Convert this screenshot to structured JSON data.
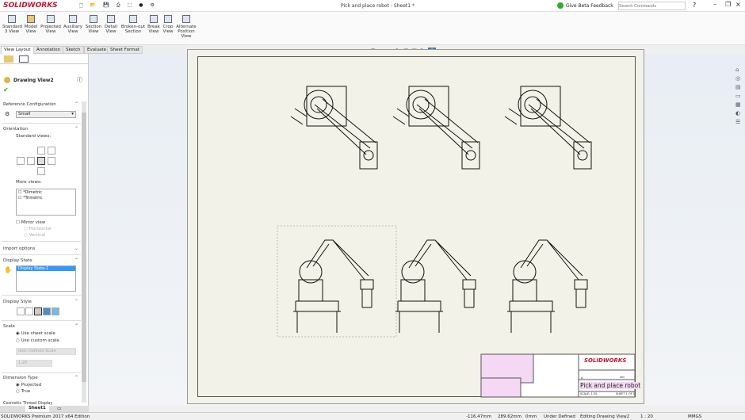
{
  "app": {
    "logo": "SOLIDWORKS",
    "title": "Pick and place robot - Sheet1 *",
    "feedback": "Give Beta Feedback",
    "search_placeholder": "Search Commands",
    "help": "?"
  },
  "ribbon": [
    {
      "label": "Standard 3 View"
    },
    {
      "label": "Model View"
    },
    {
      "label": "Projected View"
    },
    {
      "label": "Auxiliary View"
    },
    {
      "label": "Section View"
    },
    {
      "label": "Detail View"
    },
    {
      "label": "Broken-out Section"
    },
    {
      "label": "Break View"
    },
    {
      "label": "Crop View"
    },
    {
      "label": "Alternate Position View"
    }
  ],
  "tabs": [
    "View Layout",
    "Annotation",
    "Sketch",
    "Evaluate",
    "Sheet Format"
  ],
  "panel": {
    "title": "Drawing View2",
    "ref_config": {
      "heading": "Reference Configuration",
      "value": "Small"
    },
    "orientation": {
      "heading": "Orientation",
      "standard_views": "Standard views:",
      "more_views": "More views:",
      "items": [
        "*Dimetric",
        "*Trimetric"
      ],
      "mirror": "Mirror view",
      "horizontal": "Horizontal",
      "vertical": "Vertical"
    },
    "import_options": "Import options",
    "display_state": {
      "heading": "Display State",
      "value": "Display State-1"
    },
    "display_style": "Display Style",
    "scale": {
      "heading": "Scale",
      "opt1": "Use sheet scale",
      "opt2": "Use custom scale",
      "custom": "User Defined Scale",
      "value": "1:20"
    },
    "dimension_type": {
      "heading": "Dimension Type",
      "opt1": "Projected",
      "opt2": "True"
    },
    "cosmetic": "Cosmetic Thread Display"
  },
  "sheet_tab": "Sheet1",
  "titleblock": {
    "logo": "SOLIDWORKS",
    "dwg_title": "Pick and place robot",
    "size": "A",
    "scale": "SCALE: 1:20",
    "sheet": "SHEET 1 OF 1",
    "rev": "REV"
  },
  "status": {
    "edition": "SOLIDWORKS Premium 2017 x64 Edition",
    "x": "-116.47mm",
    "y": "289.62mm",
    "z": "0mm",
    "state": "Under Defined",
    "editing": "Editing Drawing View2",
    "scale": "1 : 20",
    "units": "MMGS"
  }
}
